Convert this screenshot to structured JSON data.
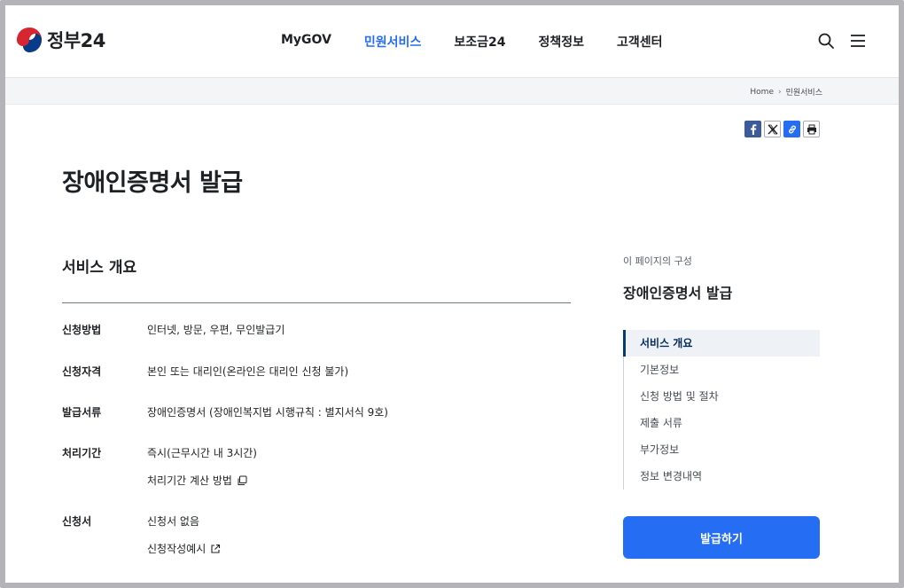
{
  "header": {
    "logo_text": "정부24",
    "nav": [
      "MyGOV",
      "민원서비스",
      "보조금24",
      "정책정보",
      "고객센터"
    ],
    "active_nav": 1
  },
  "breadcrumb": {
    "items": [
      "Home",
      "민원서비스"
    ]
  },
  "share": {
    "icons": [
      "facebook-icon",
      "x-icon",
      "link-icon",
      "print-icon"
    ]
  },
  "page": {
    "title": "장애인증명서 발급"
  },
  "overview": {
    "heading": "서비스 개요",
    "rows": [
      {
        "label": "신청방법",
        "values": [
          "인터넷, 방문, 우편, 무인발급기"
        ]
      },
      {
        "label": "신청자격",
        "values": [
          "본인 또는 대리인(온라인은 대리인 신청 불가)"
        ]
      },
      {
        "label": "발급서류",
        "values": [
          "장애인증명서 (장애인복지법 시행규칙 : 별지서식 9호)"
        ]
      },
      {
        "label": "처리기간",
        "values": [
          "즉시(근무시간 내 3시간)",
          "처리기간 계산 방법"
        ]
      },
      {
        "label": "신청서",
        "values": [
          "신청서 없음",
          "신청작성예시"
        ]
      }
    ]
  },
  "sidebar": {
    "caption": "이 페이지의 구성",
    "title": "장애인증명서 발급",
    "toc": [
      "서비스 개요",
      "기본정보",
      "신청 방법 및 절차",
      "제출 서류",
      "부가정보",
      "정보 변경내역"
    ],
    "active_toc": 0,
    "button_label": "발급하기"
  },
  "colors": {
    "accent": "#256ef4",
    "toc_active_bg": "#eef2f7",
    "toc_active_bar": "#063a74"
  }
}
